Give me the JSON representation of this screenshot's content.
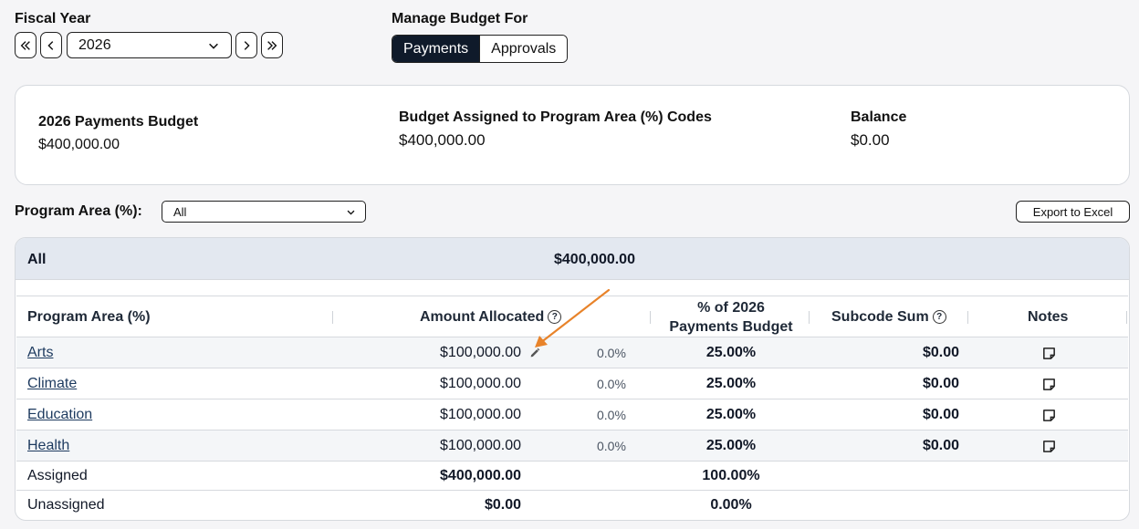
{
  "fiscal_year": {
    "label": "Fiscal Year",
    "selected": "2026"
  },
  "manage_budget": {
    "label": "Manage Budget For",
    "options": [
      "Payments",
      "Approvals"
    ],
    "selected": "Payments"
  },
  "summary": {
    "budget_title": "2026 Payments Budget",
    "budget_value": "$400,000.00",
    "assigned_title": "Budget Assigned to Program Area (%) Codes",
    "assigned_value": "$400,000.00",
    "balance_title": "Balance",
    "balance_value": "$0.00"
  },
  "filter": {
    "label": "Program Area (%):",
    "selected": "All",
    "export_label": "Export to Excel"
  },
  "table": {
    "all_row": {
      "label": "All",
      "amount": "$400,000.00"
    },
    "headers": {
      "program_area": "Program Area (%)",
      "amount_allocated": "Amount Allocated",
      "pct_budget_line1": "% of 2026",
      "pct_budget_line2": "Payments Budget",
      "subcode_sum": "Subcode Sum",
      "notes": "Notes"
    },
    "rows": [
      {
        "name": "Arts",
        "amount": "$100,000.00",
        "small_pct": "0.0%",
        "pct": "25.00%",
        "subcode": "$0.00"
      },
      {
        "name": "Climate",
        "amount": "$100,000.00",
        "small_pct": "0.0%",
        "pct": "25.00%",
        "subcode": "$0.00"
      },
      {
        "name": "Education",
        "amount": "$100,000.00",
        "small_pct": "0.0%",
        "pct": "25.00%",
        "subcode": "$0.00"
      },
      {
        "name": "Health",
        "amount": "$100,000.00",
        "small_pct": "0.0%",
        "pct": "25.00%",
        "subcode": "$0.00"
      }
    ],
    "assigned": {
      "label": "Assigned",
      "amount": "$400,000.00",
      "pct": "100.00%"
    },
    "unassigned": {
      "label": "Unassigned",
      "amount": "$0.00",
      "pct": "0.00%"
    }
  },
  "colors": {
    "accent_dark": "#0f1a2a",
    "link": "#1d3a5f",
    "annotation_arrow": "#e8832a",
    "all_row_bg": "#e3e8f0"
  },
  "icons": {
    "first": "chevrons-left-icon",
    "prev": "chevron-left-icon",
    "next": "chevron-right-icon",
    "last": "chevrons-right-icon",
    "dropdown": "chevron-down-icon",
    "help": "question-circle-icon",
    "edit": "pencil-icon",
    "notes": "note-icon"
  }
}
